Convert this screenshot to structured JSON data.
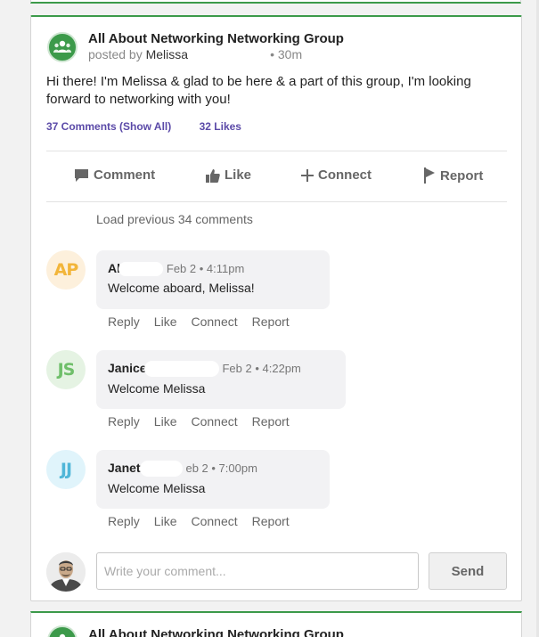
{
  "post": {
    "group_name": "All About Networking Networking Group",
    "posted_by_prefix": "posted by",
    "author_name": "Melissa",
    "time_ago": "• 30m",
    "text": "Hi there! I'm Melissa & glad to be here & a part of this group, I'm looking forward to networking with you!",
    "comments_count": "37 Comments (Show All)",
    "likes_count": "32 Likes",
    "group_icon": "people-group-icon",
    "brand_color": "#3c9a4a"
  },
  "actions": {
    "comment": "Comment",
    "like": "Like",
    "connect": "Connect",
    "report": "Report"
  },
  "load_previous": "Load previous 34 comments",
  "comments": [
    {
      "initials": "AP",
      "name": "Al",
      "meta": "Feb 2 • 4:11pm",
      "text": "Welcome aboard, Melissa!",
      "avatar_bg": "#fdf0dc",
      "avatar_fg": "#f2b53a"
    },
    {
      "initials": "JS",
      "name": "Janice",
      "meta": "Feb 2 • 4:22pm",
      "text": "Welcome Melissa",
      "avatar_bg": "#e5f3e3",
      "avatar_fg": "#6fbf6a"
    },
    {
      "initials": "JJ",
      "name": "Janet",
      "meta": "eb 2 • 7:00pm",
      "text": "Welcome Melissa",
      "avatar_bg": "#e0f4fb",
      "avatar_fg": "#4fb6d8"
    }
  ],
  "comment_actions": {
    "reply": "Reply",
    "like": "Like",
    "connect": "Connect",
    "report": "Report"
  },
  "composer": {
    "placeholder": "Write your comment...",
    "send_label": "Send"
  },
  "next_post": {
    "group_name": "All About Networking Networking Group"
  }
}
